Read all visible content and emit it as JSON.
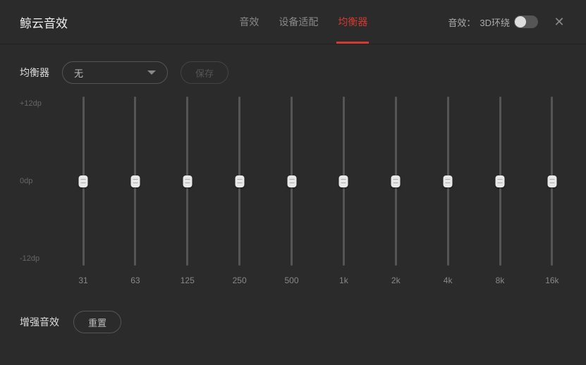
{
  "header": {
    "title": "鲸云音效",
    "tabs": [
      {
        "label": "音效",
        "active": false
      },
      {
        "label": "设备适配",
        "active": false
      },
      {
        "label": "均衡器",
        "active": true
      }
    ],
    "toggle_label": "音效：",
    "toggle_value": "3D环绕",
    "toggle_on": false
  },
  "eq": {
    "section_label": "均衡器",
    "preset_selected": "无",
    "save_label": "保存",
    "y_top": "+12dp",
    "y_mid": "0dp",
    "y_bottom": "-12dp",
    "bands": [
      {
        "freq": "31",
        "value": 0
      },
      {
        "freq": "63",
        "value": 0
      },
      {
        "freq": "125",
        "value": 0
      },
      {
        "freq": "250",
        "value": 0
      },
      {
        "freq": "500",
        "value": 0
      },
      {
        "freq": "1k",
        "value": 0
      },
      {
        "freq": "2k",
        "value": 0
      },
      {
        "freq": "4k",
        "value": 0
      },
      {
        "freq": "8k",
        "value": 0
      },
      {
        "freq": "16k",
        "value": 0
      }
    ]
  },
  "enhance": {
    "label": "增强音效",
    "reset_label": "重置"
  }
}
